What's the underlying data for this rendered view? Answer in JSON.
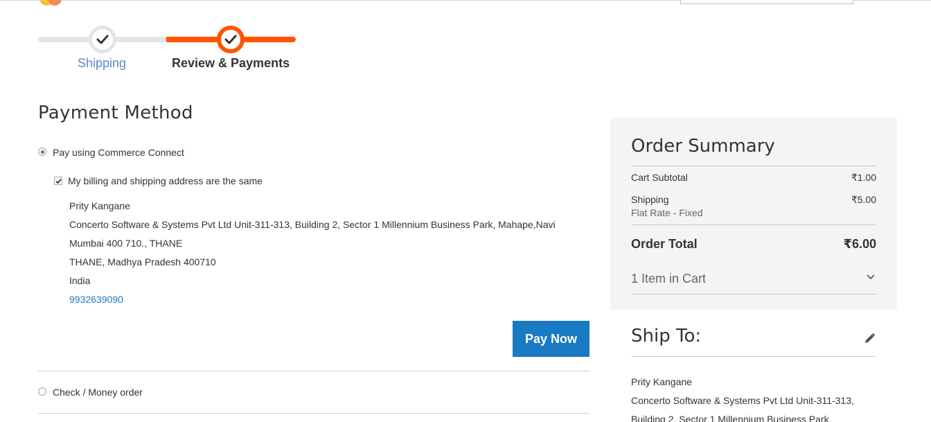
{
  "progress": {
    "steps": [
      {
        "label": "Shipping",
        "state": "complete"
      },
      {
        "label": "Review & Payments",
        "state": "active"
      }
    ],
    "active_color": "#ff5501"
  },
  "payment": {
    "title": "Payment Method",
    "options": [
      {
        "label": "Pay using Commerce Connect",
        "selected": true
      },
      {
        "label": "Check / Money order",
        "selected": false
      }
    ],
    "same_address_label": "My billing and shipping address are the same",
    "same_address_checked": true,
    "billing": {
      "name": "Prity Kangane",
      "line1": "Concerto Software & Systems Pvt Ltd Unit-311-313, Building 2, Sector 1 Millennium Business Park, Mahape,Navi",
      "line2": "Mumbai 400 710., THANE",
      "line3": "THANE, Madhya Pradesh 400710",
      "country": "India",
      "phone": "9932639090"
    },
    "pay_button": "Pay Now"
  },
  "summary": {
    "title": "Order Summary",
    "subtotal_label": "Cart Subtotal",
    "subtotal_value": "₹1.00",
    "shipping_label": "Shipping",
    "shipping_method": "Flat Rate - Fixed",
    "shipping_value": "₹5.00",
    "total_label": "Order Total",
    "total_value": "₹6.00",
    "items_label": "1 Item in Cart"
  },
  "ship_to": {
    "title": "Ship To:",
    "name": "Prity Kangane",
    "line1": "Concerto Software & Systems Pvt Ltd Unit-311-313,",
    "line2": "Building 2, Sector 1 Millennium Business Park,"
  },
  "colors": {
    "accent_orange": "#ff5501",
    "button_blue": "#1979c3",
    "link_blue": "#1979c3",
    "summary_bg": "#f4f4f4"
  }
}
